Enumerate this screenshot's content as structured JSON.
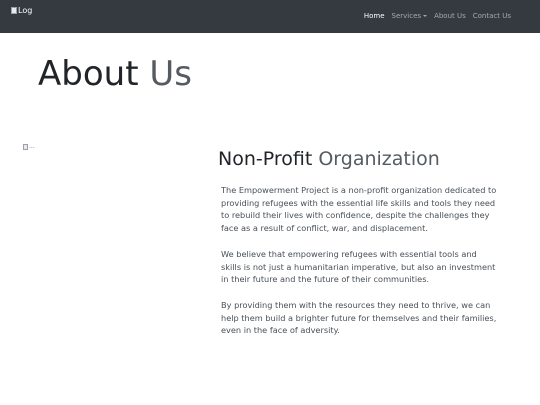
{
  "navbar": {
    "logo_alt": "Log",
    "links": [
      {
        "label": "Home"
      },
      {
        "label": "Services"
      },
      {
        "label": "About Us"
      },
      {
        "label": "Contact Us"
      }
    ]
  },
  "header": {
    "title_main": "About",
    "title_muted": "Us"
  },
  "side_image": {
    "alt": "..."
  },
  "section": {
    "title_main": "Non-Profit",
    "title_muted": "Organization",
    "paragraphs": [
      "The Empowerment Project is a non-profit organization dedicated to providing refugees with the essential life skills and tools they need to rebuild their lives with confidence, despite the challenges they face as a result of conflict, war, and displacement.",
      "We believe that empowering refugees with essential tools and skills is not just a humanitarian imperative, but also an investment in their future and the future of their communities.",
      "By providing them with the resources they need to thrive, we can help them build a brighter future for themselves and their families, even in the face of adversity."
    ]
  },
  "colors": {
    "navbar_bg": "#343a40",
    "text": "#212529",
    "muted_text": "#555b61",
    "paragraph_text": "#495057"
  }
}
